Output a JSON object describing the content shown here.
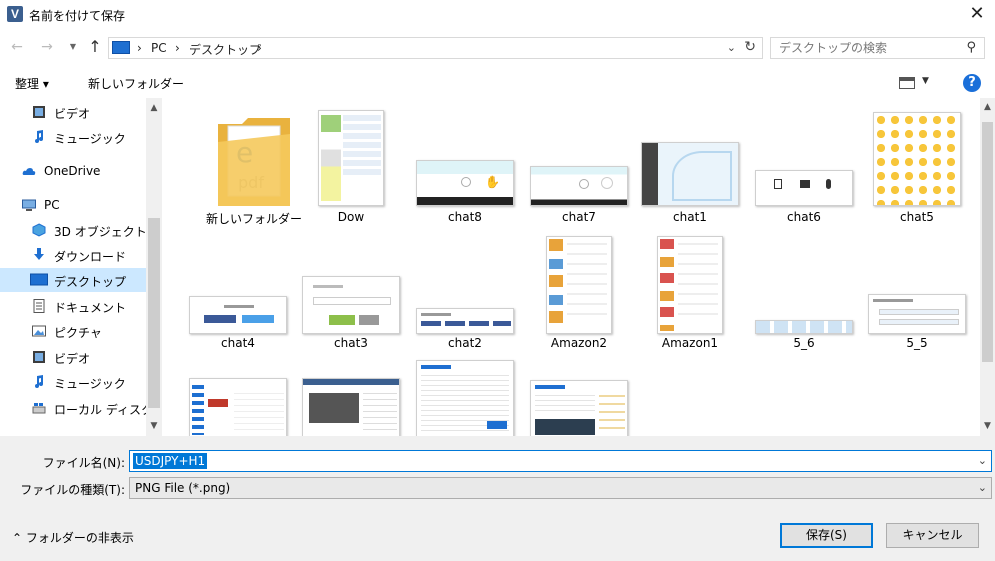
{
  "window": {
    "title": "名前を付けて保存",
    "close": "✕",
    "app_icon": "V"
  },
  "nav": {
    "back": "←",
    "forward": "→",
    "recent": "▼",
    "up": "↑",
    "breadcrumb": [
      "PC",
      "デスクトップ"
    ],
    "sep": "›",
    "search_placeholder": "デスクトップの検索"
  },
  "toolbar": {
    "organize": "整理 ▾",
    "new_folder": "新しいフォルダー"
  },
  "sidebar": {
    "items": [
      {
        "label": "ビデオ",
        "icon": "video-icon"
      },
      {
        "label": "ミュージック",
        "icon": "music-icon"
      },
      {
        "label": "OneDrive",
        "icon": "onedrive-icon"
      },
      {
        "label": "PC",
        "icon": "pc-icon"
      },
      {
        "label": "3D オブジェクト",
        "icon": "3d-objects-icon"
      },
      {
        "label": "ダウンロード",
        "icon": "download-icon"
      },
      {
        "label": "デスクトップ",
        "icon": "desktop-icon",
        "selected": true
      },
      {
        "label": "ドキュメント",
        "icon": "document-icon"
      },
      {
        "label": "ピクチャ",
        "icon": "pictures-icon"
      },
      {
        "label": "ビデオ",
        "icon": "video-icon"
      },
      {
        "label": "ミュージック",
        "icon": "music-icon"
      },
      {
        "label": "ローカル ディスク (C",
        "icon": "disk-icon"
      }
    ]
  },
  "files": [
    {
      "label": "新しいフォルダー",
      "kind": "folder"
    },
    {
      "label": "Dow",
      "kind": "image"
    },
    {
      "label": "chat8",
      "kind": "image"
    },
    {
      "label": "chat7",
      "kind": "image"
    },
    {
      "label": "chat1",
      "kind": "image"
    },
    {
      "label": "chat6",
      "kind": "image"
    },
    {
      "label": "chat5",
      "kind": "image"
    },
    {
      "label": "chat4",
      "kind": "image"
    },
    {
      "label": "chat3",
      "kind": "image"
    },
    {
      "label": "chat2",
      "kind": "image"
    },
    {
      "label": "Amazon2",
      "kind": "image"
    },
    {
      "label": "Amazon1",
      "kind": "image"
    },
    {
      "label": "5_6",
      "kind": "image"
    },
    {
      "label": "5_5",
      "kind": "image"
    },
    {
      "label": "",
      "kind": "image"
    },
    {
      "label": "",
      "kind": "image"
    },
    {
      "label": "",
      "kind": "image"
    },
    {
      "label": "",
      "kind": "image"
    }
  ],
  "form": {
    "filename_label": "ファイル名(N):",
    "filename_value": "USDJPY+H1",
    "filetype_label": "ファイルの種類(T):",
    "filetype_value": "PNG File (*.png)",
    "hide_folders": "フォルダーの非表示",
    "save": "保存(S)",
    "cancel": "キャンセル"
  },
  "colors": {
    "accent": "#0078d7",
    "selected_bg": "#cce8ff",
    "dialog_bg": "#f0f0f0",
    "folder": "#f5c95c"
  }
}
